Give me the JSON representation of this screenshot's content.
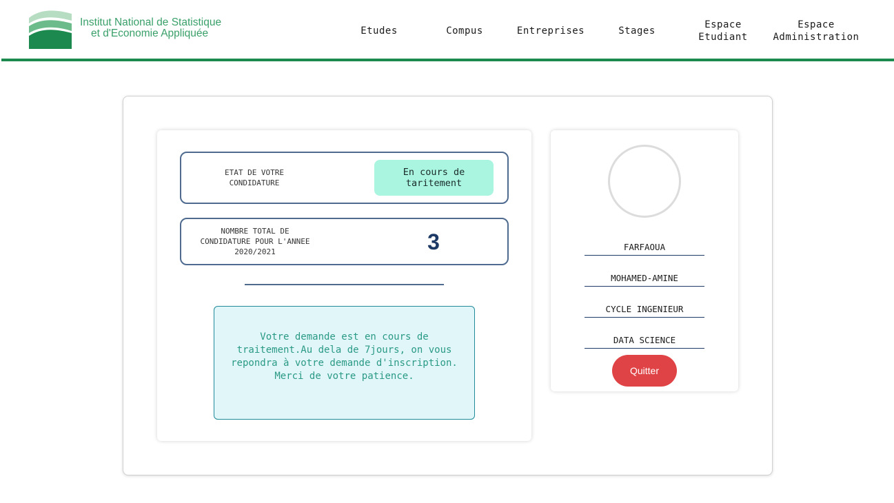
{
  "header": {
    "logo": {
      "line1": "Institut National de Statistique",
      "line2": "et d'Economie Appliquée",
      "colors": {
        "dark": "#1c8a4f",
        "mid": "#6cbb8a",
        "light": "#b6dcc2"
      }
    },
    "nav": [
      {
        "label": "Etudes"
      },
      {
        "label": "Compus"
      },
      {
        "label": "Entreprises"
      },
      {
        "label": "Stages"
      },
      {
        "label": "Espace\nEtudiant"
      },
      {
        "label": "Espace\nAdministration"
      }
    ],
    "accent_color": "#1c8a4f"
  },
  "status": {
    "label": "ETAT DE VOTRE CONDIDATURE",
    "value": "En cours de taritement",
    "pill_color": "#a9f5e0"
  },
  "count": {
    "label": "NOMBRE TOTAL DE CONDIDATURE POUR L'ANNEE 2020/2021",
    "value": "3"
  },
  "message": {
    "text": "Votre demande est en cours de traitement.Au dela de 7jours, on vous repondra à votre demande d'inscription. Merci de votre patience."
  },
  "profile": {
    "last_name": "FARFAOUA",
    "first_name": "MOHAMED-AMINE",
    "cycle": "CYCLE INGENIEUR",
    "field": "DATA SCIENCE",
    "quit_label": "Quitter",
    "quit_color": "#e04345"
  }
}
